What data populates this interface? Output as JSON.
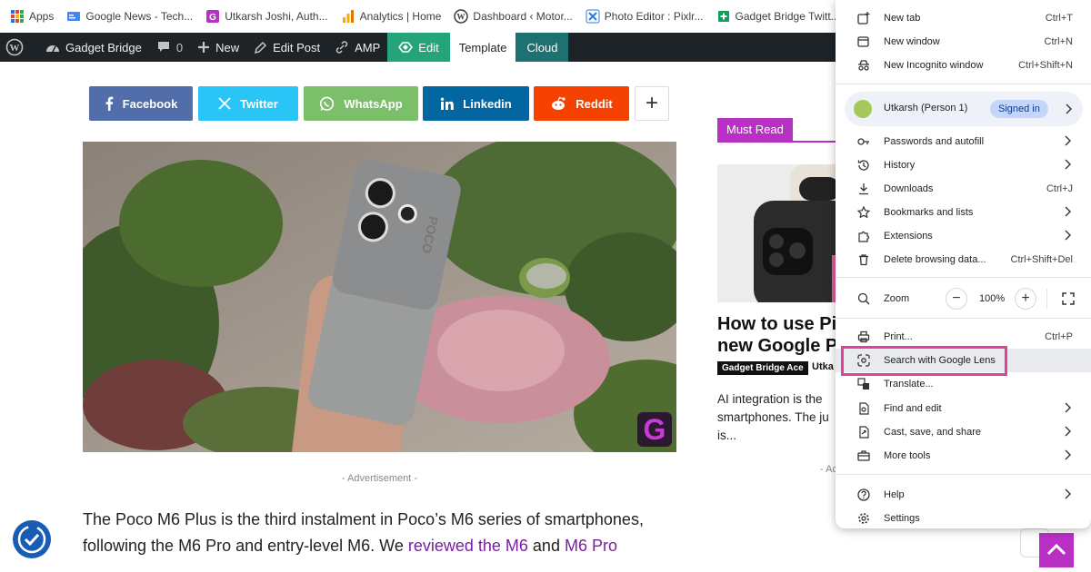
{
  "bookmarks": [
    {
      "label": "Apps"
    },
    {
      "label": "Google News - Tech..."
    },
    {
      "label": "Utkarsh Joshi, Auth..."
    },
    {
      "label": "Analytics | Home"
    },
    {
      "label": "Dashboard ‹ Motor..."
    },
    {
      "label": "Photo Editor : Pixlr..."
    },
    {
      "label": "Gadget Bridge Twitt..."
    }
  ],
  "wp_bar": {
    "site": "Gadget Bridge",
    "comments": "0",
    "new": "New",
    "edit_post": "Edit Post",
    "amp": "AMP",
    "edit": "Edit",
    "template": "Template",
    "cloud": "Cloud"
  },
  "share": {
    "facebook": "Facebook",
    "twitter": "Twitter",
    "whatsapp": "WhatsApp",
    "linkedin": "Linkedin",
    "reddit": "Reddit",
    "more": "+"
  },
  "colors": {
    "facebook": "#516eab",
    "twitter": "#29c5f6",
    "whatsapp": "#7bbf6a",
    "linkedin": "#0266a0",
    "reddit": "#f54200",
    "accent": "#b830c4",
    "highlight": "#e040a0"
  },
  "article": {
    "advertisement": "- Advertisement -",
    "text_1": "The Poco M6 Plus is the third instalment in Poco’s M6 series of smartphones,",
    "text_2": "following the M6 Pro and entry-level M6. We ",
    "link_1": "reviewed the M6",
    "text_3": " and ",
    "link_2": "M6 Pro"
  },
  "sidebar": {
    "must_read": "Must Read",
    "title_1": "How to use Pix",
    "title_2": "new Google Pi",
    "tag": "Gadget Bridge Ace",
    "author": "Utka",
    "excerpt_1": "AI integration is the",
    "excerpt_2": "smartphones. The ju",
    "excerpt_3": "is...",
    "adv": "- Ac"
  },
  "menu": {
    "new_tab": {
      "label": "New tab",
      "shortcut": "Ctrl+T"
    },
    "new_window": {
      "label": "New window",
      "shortcut": "Ctrl+N"
    },
    "incognito": {
      "label": "New Incognito window",
      "shortcut": "Ctrl+Shift+N"
    },
    "profile_name": "Utkarsh (Person 1)",
    "signed_in": "Signed in",
    "passwords": {
      "label": "Passwords and autofill"
    },
    "history": {
      "label": "History"
    },
    "downloads": {
      "label": "Downloads",
      "shortcut": "Ctrl+J"
    },
    "bookmarks": {
      "label": "Bookmarks and lists"
    },
    "extensions": {
      "label": "Extensions"
    },
    "delete_data": {
      "label": "Delete browsing data...",
      "shortcut": "Ctrl+Shift+Del"
    },
    "zoom": {
      "label": "Zoom",
      "value": "100%",
      "minus": "−",
      "plus": "+"
    },
    "print": {
      "label": "Print...",
      "shortcut": "Ctrl+P"
    },
    "lens": {
      "label": "Search with Google Lens"
    },
    "translate": {
      "label": "Translate..."
    },
    "find_edit": {
      "label": "Find and edit"
    },
    "cast": {
      "label": "Cast, save, and share"
    },
    "more_tools": {
      "label": "More tools"
    },
    "help": {
      "label": "Help"
    },
    "settings": {
      "label": "Settings"
    }
  }
}
